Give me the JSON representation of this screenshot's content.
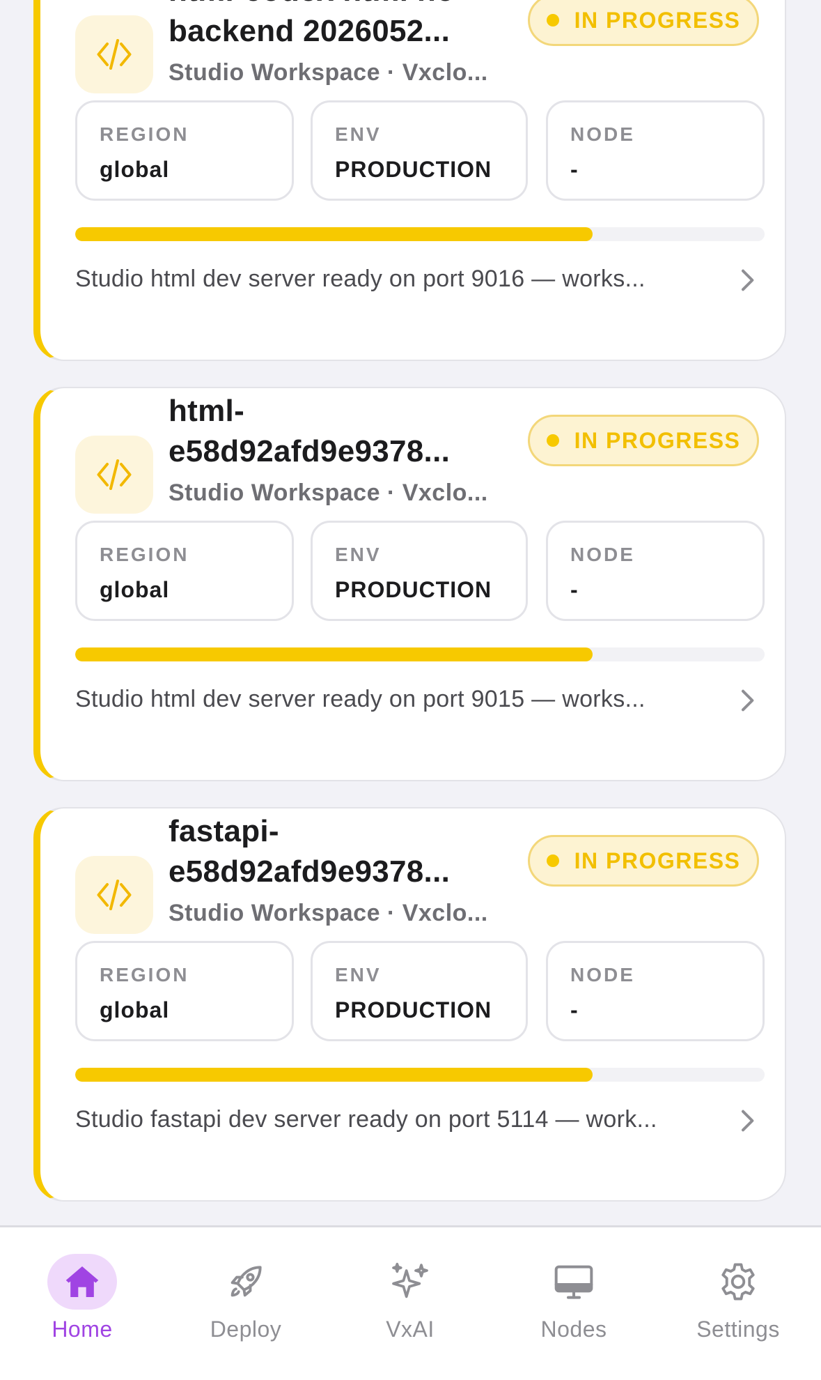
{
  "cards": [
    {
      "title_line1": "html-codex html no",
      "title_line2": "backend 2026052...",
      "subtitle": "Studio Workspace · Vxclo...",
      "status": "IN PROGRESS",
      "region_label": "REGION",
      "region_value": "global",
      "env_label": "ENV",
      "env_value": "PRODUCTION",
      "node_label": "NODE",
      "node_value": "-",
      "progress": 0.75,
      "message": "Studio html dev server ready on port 9016 — works..."
    },
    {
      "title_line1": "html-",
      "title_line2": "e58d92afd9e9378...",
      "subtitle": "Studio Workspace · Vxclo...",
      "status": "IN PROGRESS",
      "region_label": "REGION",
      "region_value": "global",
      "env_label": "ENV",
      "env_value": "PRODUCTION",
      "node_label": "NODE",
      "node_value": "-",
      "progress": 0.75,
      "message": "Studio html dev server ready on port 9015 — works..."
    },
    {
      "title_line1": "fastapi-",
      "title_line2": "e58d92afd9e9378...",
      "subtitle": "Studio Workspace · Vxclo...",
      "status": "IN PROGRESS",
      "region_label": "REGION",
      "region_value": "global",
      "env_label": "ENV",
      "env_value": "PRODUCTION",
      "node_label": "NODE",
      "node_value": "-",
      "progress": 0.75,
      "message": "Studio fastapi dev server ready on port 5114 — work..."
    }
  ],
  "tabs": [
    {
      "label": "Home",
      "icon": "home-icon",
      "active": true
    },
    {
      "label": "Deploy",
      "icon": "rocket-icon",
      "active": false
    },
    {
      "label": "VxAI",
      "icon": "sparkles-icon",
      "active": false
    },
    {
      "label": "Nodes",
      "icon": "monitor-icon",
      "active": false
    },
    {
      "label": "Settings",
      "icon": "gear-icon",
      "active": false
    }
  ],
  "colors": {
    "accent": "#f7c900",
    "active_tab": "#a044e3",
    "inactive_tab": "#8e8e93"
  }
}
